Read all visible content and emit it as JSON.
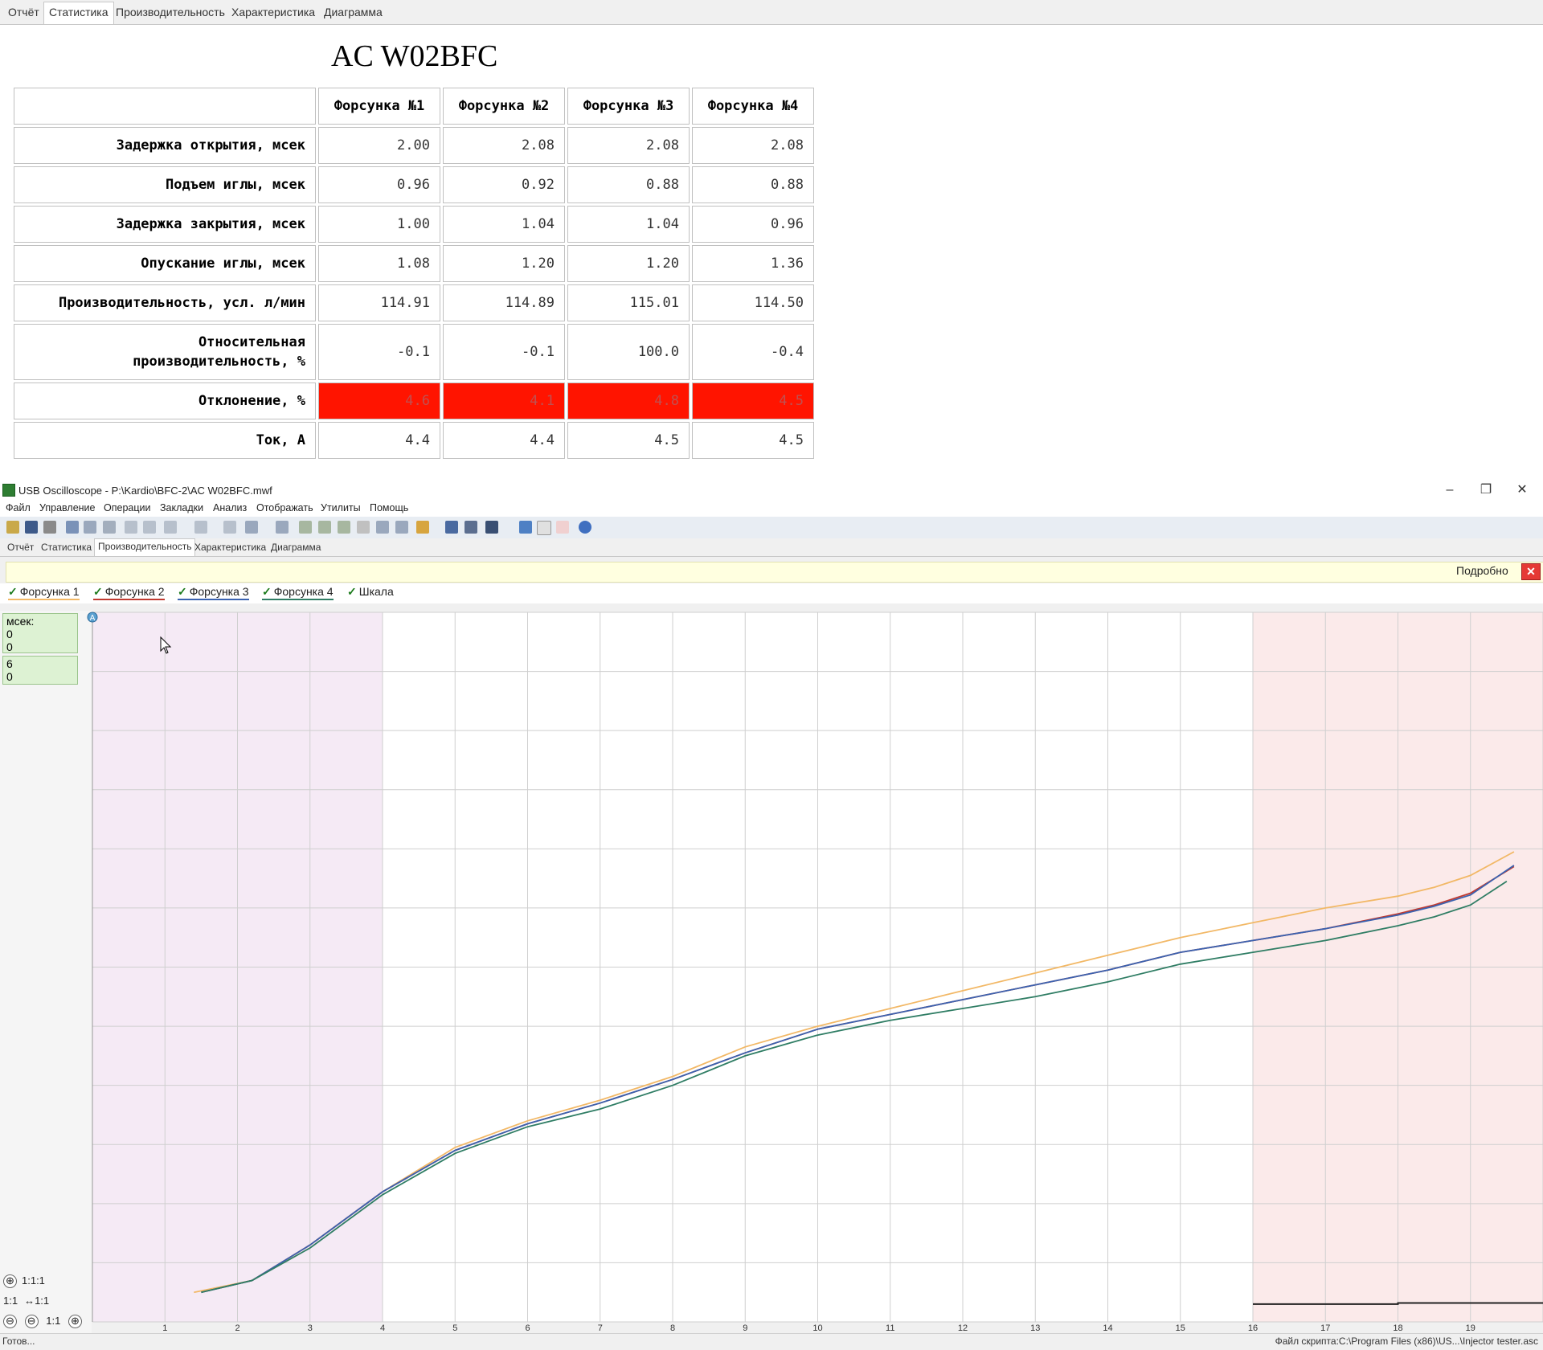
{
  "report": {
    "tabs": [
      "Отчёт",
      "Статистика",
      "Производительность",
      "Характеристика",
      "Диаграмма"
    ],
    "active_tab": 1,
    "title": "AC W02BFC",
    "columns": [
      "Форсунка №1",
      "Форсунка №2",
      "Форсунка №3",
      "Форсунка №4"
    ],
    "rows": [
      {
        "label": "Задержка открытия, мсек",
        "values": [
          "2.00",
          "2.08",
          "2.08",
          "2.08"
        ]
      },
      {
        "label": "Подъем иглы, мсек",
        "values": [
          "0.96",
          "0.92",
          "0.88",
          "0.88"
        ]
      },
      {
        "label": "Задержка закрытия, мсек",
        "values": [
          "1.00",
          "1.04",
          "1.04",
          "0.96"
        ]
      },
      {
        "label": "Опускание иглы, мсек",
        "values": [
          "1.08",
          "1.20",
          "1.20",
          "1.36"
        ]
      },
      {
        "label": "Производительность, усл. л/мин",
        "values": [
          "114.91",
          "114.89",
          "115.01",
          "114.50"
        ]
      },
      {
        "label": "Относительная\nпроизводительность, %",
        "values": [
          "-0.1",
          "-0.1",
          "100.0",
          "-0.4"
        ]
      },
      {
        "label": "Отклонение, %",
        "values": [
          "4.6",
          "4.1",
          "4.8",
          "4.5"
        ],
        "highlight": true
      },
      {
        "label": "Ток, А",
        "values": [
          "4.4",
          "4.4",
          "4.5",
          "4.5"
        ]
      }
    ],
    "highlight_color": "#ff1400"
  },
  "window": {
    "title": "USB Oscilloscope - P:\\Kardio\\BFC-2\\AC W02BFC.mwf",
    "controls": {
      "minimize": "–",
      "restore": "❐",
      "close": "✕"
    },
    "menu": [
      "Файл",
      "Управление",
      "Операции",
      "Закладки",
      "Анализ",
      "Отображать",
      "Утилиты",
      "Помощь"
    ],
    "tabs": [
      "Отчёт",
      "Статистика",
      "Производительность",
      "Характеристика",
      "Диаграмма"
    ],
    "active_tab": 2,
    "details_label": "Подробно",
    "legend": [
      {
        "label": "Форсунка 1",
        "color": "#f2b866"
      },
      {
        "label": "Форсунка 2",
        "color": "#c03a30"
      },
      {
        "label": "Форсунка 3",
        "color": "#3a62b0"
      },
      {
        "label": "Форсунка 4",
        "color": "#2f7d64"
      },
      {
        "label": "Шкала",
        "color": "#888888"
      }
    ],
    "cursor_panel": {
      "unit": "мсек:",
      "lines_a": [
        "0",
        "0"
      ],
      "lines_b": [
        "6",
        "0"
      ]
    },
    "zoom": {
      "plus_label": "⊕",
      "ratio1": "1:1:1",
      "fit_label": "1:1",
      "ratio2": "↔1:1",
      "minus_label": "⊖",
      "one_to_one": "1:1",
      "add_label": "⊕"
    },
    "status_left": "Готов...",
    "status_right": "Файл скрипта:C:\\Program Files (x86)\\US...\\Injector tester.asc"
  },
  "chart_data": {
    "type": "line",
    "x_ticks": [
      "1",
      "2",
      "3",
      "4",
      "5",
      "6",
      "7",
      "8",
      "9",
      "10",
      "11",
      "12",
      "13",
      "14",
      "15",
      "16",
      "17",
      "18",
      "19"
    ],
    "xlim": [
      0,
      20
    ],
    "ylim": [
      0,
      12
    ],
    "grid": true,
    "shaded_ranges": [
      {
        "from": 0,
        "to": 4,
        "color": "#f5eaf5"
      },
      {
        "from": 16,
        "to": 20,
        "color": "#fbeaea"
      }
    ],
    "series": [
      {
        "name": "Форсунка 1",
        "color": "#f2b866",
        "x": [
          1.4,
          2.2,
          3.0,
          4.0,
          5.0,
          6.0,
          7.0,
          8.0,
          9.0,
          10.0,
          11.0,
          12.0,
          13.0,
          14.0,
          15.0,
          16.0,
          17.0,
          18.0,
          18.5,
          19.0,
          19.6
        ],
        "y": [
          0.5,
          0.7,
          1.3,
          2.2,
          2.95,
          3.4,
          3.75,
          4.15,
          4.65,
          5.0,
          5.3,
          5.6,
          5.9,
          6.2,
          6.5,
          6.75,
          7.0,
          7.2,
          7.35,
          7.55,
          7.95
        ]
      },
      {
        "name": "Форсунка 2",
        "color": "#c03a30",
        "x": [
          1.5,
          2.2,
          3.0,
          4.0,
          5.0,
          6.0,
          7.0,
          8.0,
          9.0,
          10.0,
          11.0,
          12.0,
          13.0,
          14.0,
          15.0,
          16.0,
          17.0,
          18.0,
          18.5,
          19.0,
          19.6
        ],
        "y": [
          0.5,
          0.7,
          1.3,
          2.2,
          2.9,
          3.35,
          3.7,
          4.1,
          4.55,
          4.95,
          5.2,
          5.45,
          5.7,
          5.95,
          6.25,
          6.45,
          6.65,
          6.9,
          7.05,
          7.25,
          7.7
        ]
      },
      {
        "name": "Форсунка 3",
        "color": "#3a62b0",
        "x": [
          1.5,
          2.2,
          3.0,
          4.0,
          5.0,
          6.0,
          7.0,
          8.0,
          9.0,
          10.0,
          11.0,
          12.0,
          13.0,
          14.0,
          15.0,
          16.0,
          17.0,
          18.0,
          18.5,
          19.0,
          19.6
        ],
        "y": [
          0.5,
          0.7,
          1.3,
          2.2,
          2.9,
          3.35,
          3.7,
          4.1,
          4.55,
          4.95,
          5.2,
          5.45,
          5.7,
          5.95,
          6.25,
          6.45,
          6.65,
          6.88,
          7.03,
          7.22,
          7.72
        ]
      },
      {
        "name": "Форсунка 4",
        "color": "#2f7d64",
        "x": [
          1.5,
          2.2,
          3.0,
          4.0,
          5.0,
          6.0,
          7.0,
          8.0,
          9.0,
          10.0,
          11.0,
          12.0,
          13.0,
          14.0,
          15.0,
          16.0,
          17.0,
          18.0,
          18.5,
          19.0,
          19.5
        ],
        "y": [
          0.5,
          0.7,
          1.25,
          2.15,
          2.85,
          3.3,
          3.6,
          4.0,
          4.5,
          4.85,
          5.1,
          5.3,
          5.5,
          5.75,
          6.05,
          6.25,
          6.45,
          6.7,
          6.85,
          7.05,
          7.45
        ]
      },
      {
        "name": "Шкала",
        "color": "#222222",
        "x": [
          16.0,
          18.0,
          18.0,
          20.0
        ],
        "y": [
          0.3,
          0.3,
          0.32,
          0.32
        ]
      }
    ]
  }
}
